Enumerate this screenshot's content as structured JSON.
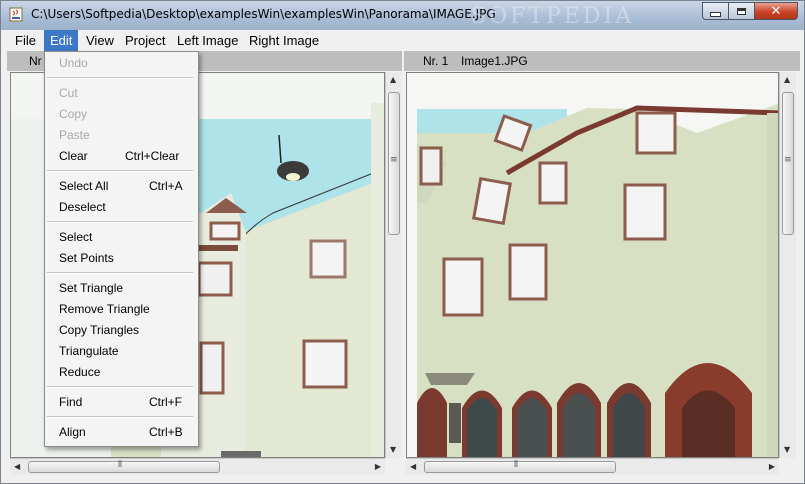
{
  "window": {
    "title": "C:\\Users\\Softpedia\\Desktop\\examplesWin\\examplesWin\\Panorama\\IMAGE.JPG",
    "watermark": "SOFTPEDIA"
  },
  "menubar": [
    {
      "label": "File"
    },
    {
      "label": "Edit",
      "active": true
    },
    {
      "label": "View"
    },
    {
      "label": "Project"
    },
    {
      "label": "Left Image"
    },
    {
      "label": "Right Image"
    }
  ],
  "left_panel": {
    "prefix": "Nr"
  },
  "right_panel": {
    "number": "Nr. 1",
    "filename": "Image1.JPG"
  },
  "edit_menu": {
    "undo": "Undo",
    "cut": "Cut",
    "copy": "Copy",
    "paste": "Paste",
    "clear": "Clear",
    "clear_shortcut": "Ctrl+Clear",
    "select_all": "Select All",
    "select_all_shortcut": "Ctrl+A",
    "deselect": "Deselect",
    "select": "Select",
    "set_points": "Set Points",
    "set_triangle": "Set Triangle",
    "remove_triangle": "Remove Triangle",
    "copy_triangles": "Copy Triangles",
    "triangulate": "Triangulate",
    "reduce": "Reduce",
    "find": "Find",
    "find_shortcut": "Ctrl+F",
    "align": "Align",
    "align_shortcut": "Ctrl+B"
  },
  "colors": {
    "menu_highlight": "#3c78c6",
    "panel_header": "#bdbdbd",
    "sky": "#aee3ea",
    "facade": "#d9e0c6"
  }
}
